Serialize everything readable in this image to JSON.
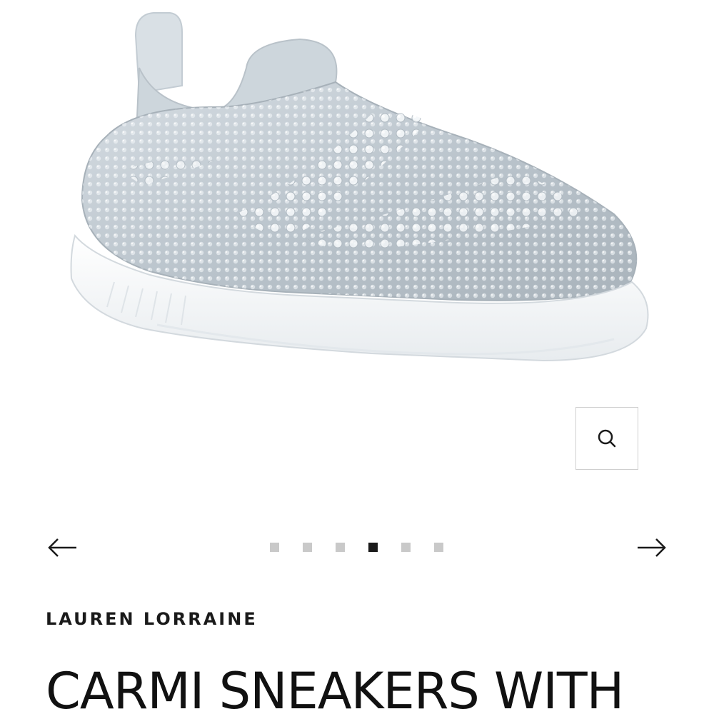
{
  "product": {
    "image_alt": "Silver rhinestone slip-on sneaker",
    "brand": "LAUREN LORRAINE",
    "title": "CARMI SNEAKERS WITH"
  },
  "gallery": {
    "zoom_icon": "search-icon",
    "prev_icon": "arrow-left-icon",
    "next_icon": "arrow-right-icon",
    "image_count": 6,
    "active_index": 3
  },
  "colors": {
    "dot_inactive": "#c9c9c9",
    "dot_active": "#1a1a1a",
    "text": "#111111"
  }
}
